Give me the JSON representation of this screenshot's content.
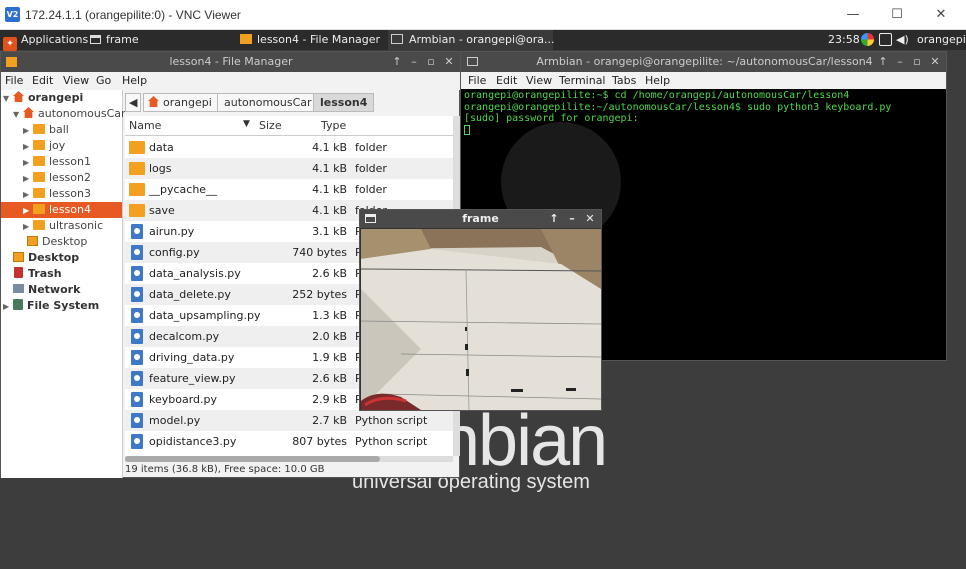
{
  "vnc": {
    "logo": "V2",
    "title": "172.24.1.1 (orangepilite:0) - VNC Viewer",
    "controls": [
      "—",
      "☐",
      "✕"
    ]
  },
  "panel": {
    "applications": "Applications",
    "tasks": [
      {
        "label": "frame",
        "icon": "window-icon"
      },
      {
        "label": "lesson4 - File Manager",
        "icon": "folder-icon"
      },
      {
        "label": "Armbian - orangepi@ora...",
        "icon": "terminal-icon"
      }
    ],
    "clock": "23:58",
    "user": "orangepi"
  },
  "desktop": {
    "brand_main": "nbian",
    "brand_sub": "universal operating system"
  },
  "file_manager": {
    "title": "lesson4 - File Manager",
    "controls": [
      "↑",
      "–",
      "▫",
      "✕"
    ],
    "menu": [
      "File",
      "Edit",
      "View",
      "Go",
      "Help"
    ],
    "sidebar": {
      "home": "orangepi",
      "project": "autonomousCar",
      "folders": [
        "ball",
        "joy",
        "lesson1",
        "lesson2",
        "lesson3",
        "lesson4",
        "ultrasonic"
      ],
      "desktop_sub": "Desktop",
      "places": [
        "Desktop",
        "Trash",
        "Network",
        "File System"
      ]
    },
    "path": {
      "back": "◀",
      "crumbs": [
        "orangepi",
        "autonomousCar",
        "lesson4"
      ]
    },
    "columns": {
      "name": "Name",
      "size": "Size",
      "type": "Type",
      "sort_arrow": "▼"
    },
    "rows": [
      {
        "name": "data",
        "size": "4.1 kB",
        "type": "folder",
        "kind": "folder"
      },
      {
        "name": "logs",
        "size": "4.1 kB",
        "type": "folder",
        "kind": "folder"
      },
      {
        "name": "__pycache__",
        "size": "4.1 kB",
        "type": "folder",
        "kind": "folder"
      },
      {
        "name": "save",
        "size": "4.1 kB",
        "type": "folder",
        "kind": "folder"
      },
      {
        "name": "airun.py",
        "size": "3.1 kB",
        "type": "Python s",
        "kind": "py"
      },
      {
        "name": "config.py",
        "size": "740 bytes",
        "type": "Python s",
        "kind": "py"
      },
      {
        "name": "data_analysis.py",
        "size": "2.6 kB",
        "type": "Python s",
        "kind": "py"
      },
      {
        "name": "data_delete.py",
        "size": "252 bytes",
        "type": "Python s",
        "kind": "py"
      },
      {
        "name": "data_upsampling.py",
        "size": "1.3 kB",
        "type": "Python s",
        "kind": "py"
      },
      {
        "name": "decalcom.py",
        "size": "2.0 kB",
        "type": "Python s",
        "kind": "py"
      },
      {
        "name": "driving_data.py",
        "size": "1.9 kB",
        "type": "Python s",
        "kind": "py"
      },
      {
        "name": "feature_view.py",
        "size": "2.6 kB",
        "type": "Python s",
        "kind": "py"
      },
      {
        "name": "keyboard.py",
        "size": "2.9 kB",
        "type": "Python s",
        "kind": "py"
      },
      {
        "name": "model.py",
        "size": "2.7 kB",
        "type": "Python script",
        "kind": "py"
      },
      {
        "name": "opidistance3.py",
        "size": "807 bytes",
        "type": "Python script",
        "kind": "py"
      }
    ],
    "status": "19 items (36.8 kB), Free space: 10.0 GB"
  },
  "terminal": {
    "title": "Armbian - orangepi@orangepilite: ~/autonomousCar/lesson4",
    "controls": [
      "↑",
      "–",
      "▫",
      "✕"
    ],
    "menu": [
      "File",
      "Edit",
      "View",
      "Terminal",
      "Tabs",
      "Help"
    ],
    "lines": [
      "orangepi@orangepilite:~$ cd /home/orangepi/autonomousCar/lesson4",
      "orangepi@orangepilite:~/autonomousCar/lesson4$ sudo python3 keyboard.py",
      "[sudo] password for orangepi:"
    ]
  },
  "frame": {
    "title": "frame",
    "controls": [
      "↑",
      "–",
      "✕"
    ]
  }
}
